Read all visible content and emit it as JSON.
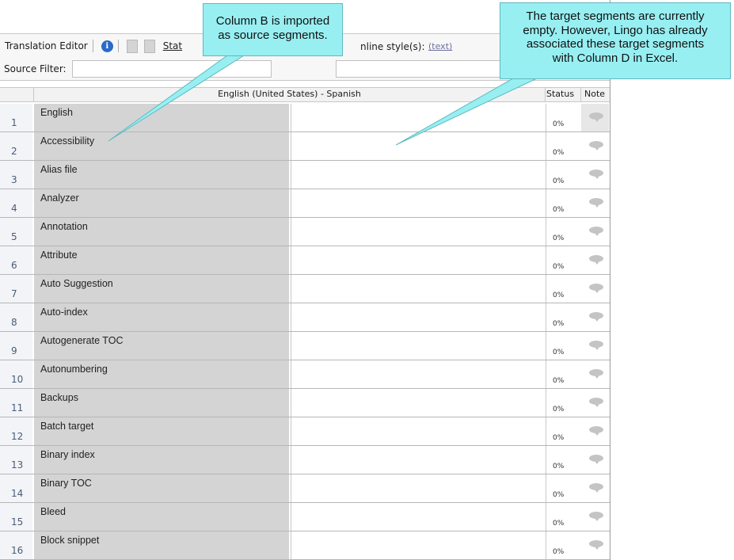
{
  "toolbar": {
    "title": "Translation Editor",
    "stats_link": "Stat",
    "inline_label": "nline style(s):",
    "inline_value": "(text)"
  },
  "filter": {
    "source_label": "Source Filter:"
  },
  "grid": {
    "language_pair": "English (United States) - Spanish",
    "status_header": "Status",
    "note_header": "Note",
    "rows": [
      {
        "num": "1",
        "source": "English",
        "status": "0%"
      },
      {
        "num": "2",
        "source": "Accessibility",
        "status": "0%"
      },
      {
        "num": "3",
        "source": "Alias file",
        "status": "0%"
      },
      {
        "num": "4",
        "source": "Analyzer",
        "status": "0%"
      },
      {
        "num": "5",
        "source": "Annotation",
        "status": "0%"
      },
      {
        "num": "6",
        "source": "Attribute",
        "status": "0%"
      },
      {
        "num": "7",
        "source": "Auto Suggestion",
        "status": "0%"
      },
      {
        "num": "8",
        "source": "Auto-index",
        "status": "0%"
      },
      {
        "num": "9",
        "source": "Autogenerate TOC",
        "status": "0%"
      },
      {
        "num": "10",
        "source": "Autonumbering",
        "status": "0%"
      },
      {
        "num": "11",
        "source": "Backups",
        "status": "0%"
      },
      {
        "num": "12",
        "source": "Batch target",
        "status": "0%"
      },
      {
        "num": "13",
        "source": "Binary index",
        "status": "0%"
      },
      {
        "num": "14",
        "source": "Binary TOC",
        "status": "0%"
      },
      {
        "num": "15",
        "source": "Bleed",
        "status": "0%"
      },
      {
        "num": "16",
        "source": "Block snippet",
        "status": "0%"
      }
    ]
  },
  "callouts": {
    "source_note_line1": "Column B is imported",
    "source_note_line2": "as source segments.",
    "target_note_line1": "The target segments are currently",
    "target_note_line2": "empty. However, Lingo has already",
    "target_note_line3": "associated these target segments",
    "target_note_line4": "with Column D in Excel."
  },
  "colors": {
    "callout_fill": "#98eff2",
    "source_cell": "#d4d4d4",
    "info_icon": "#2a6ac9"
  }
}
